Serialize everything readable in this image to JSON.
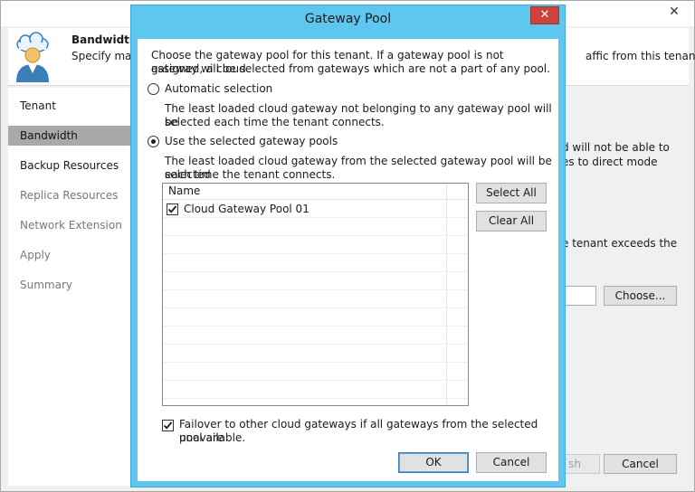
{
  "background_window": {
    "close_glyph": "✕",
    "header": {
      "title": "Bandwidth",
      "subtitle_start": "Specify maxi",
      "subtitle_end": "affic from this tenant."
    },
    "sidebar": {
      "items": [
        {
          "label": "Tenant",
          "state": "normal"
        },
        {
          "label": "Bandwidth",
          "state": "active"
        },
        {
          "label": "Backup Resources",
          "state": "normal"
        },
        {
          "label": "Replica Resources",
          "state": "disabled"
        },
        {
          "label": "Network Extension",
          "state": "disabled"
        },
        {
          "label": "Apply",
          "state": "disabled"
        },
        {
          "label": "Summary",
          "state": "disabled"
        }
      ]
    },
    "main": {
      "text_1a": "d will not be able to",
      "text_1b": "es to direct mode",
      "text_2": "e tenant exceeds the",
      "choose_button": "Choose...",
      "finish_button_partial": "sh",
      "cancel_button": "Cancel"
    }
  },
  "dialog": {
    "title": "Gateway Pool",
    "close_glyph": "✕",
    "intro_line1": "Choose the gateway pool for this tenant. If a gateway pool is not assigned, a cloud",
    "intro_line2": "gateway will be selected from gateways which are not a part of any pool.",
    "option_auto": {
      "label": "Automatic selection",
      "desc_line1": "The least loaded cloud gateway not belonging to any gateway pool will be",
      "desc_line2": "selected each time the tenant connects.",
      "selected": false
    },
    "option_selected": {
      "label": "Use the selected gateway pools",
      "desc_line1": "The least loaded cloud gateway from the selected gateway pool will be selected",
      "desc_line2": "each time the tenant connects.",
      "selected": true
    },
    "pools_table": {
      "column_header": "Name",
      "rows": [
        {
          "name": "Cloud Gateway Pool 01",
          "checked": true
        }
      ]
    },
    "select_all_button": "Select All",
    "clear_all_button": "Clear All",
    "failover": {
      "label_line1": "Failover to other cloud gateways if all gateways from the selected pool are",
      "label_line2": "unavailable.",
      "checked": true
    },
    "ok_button": "OK",
    "cancel_button": "Cancel"
  },
  "colors": {
    "dialog_frame": "#5ec7ef",
    "close_button": "#c9443a",
    "sidebar_active": "#a9a9a9"
  }
}
